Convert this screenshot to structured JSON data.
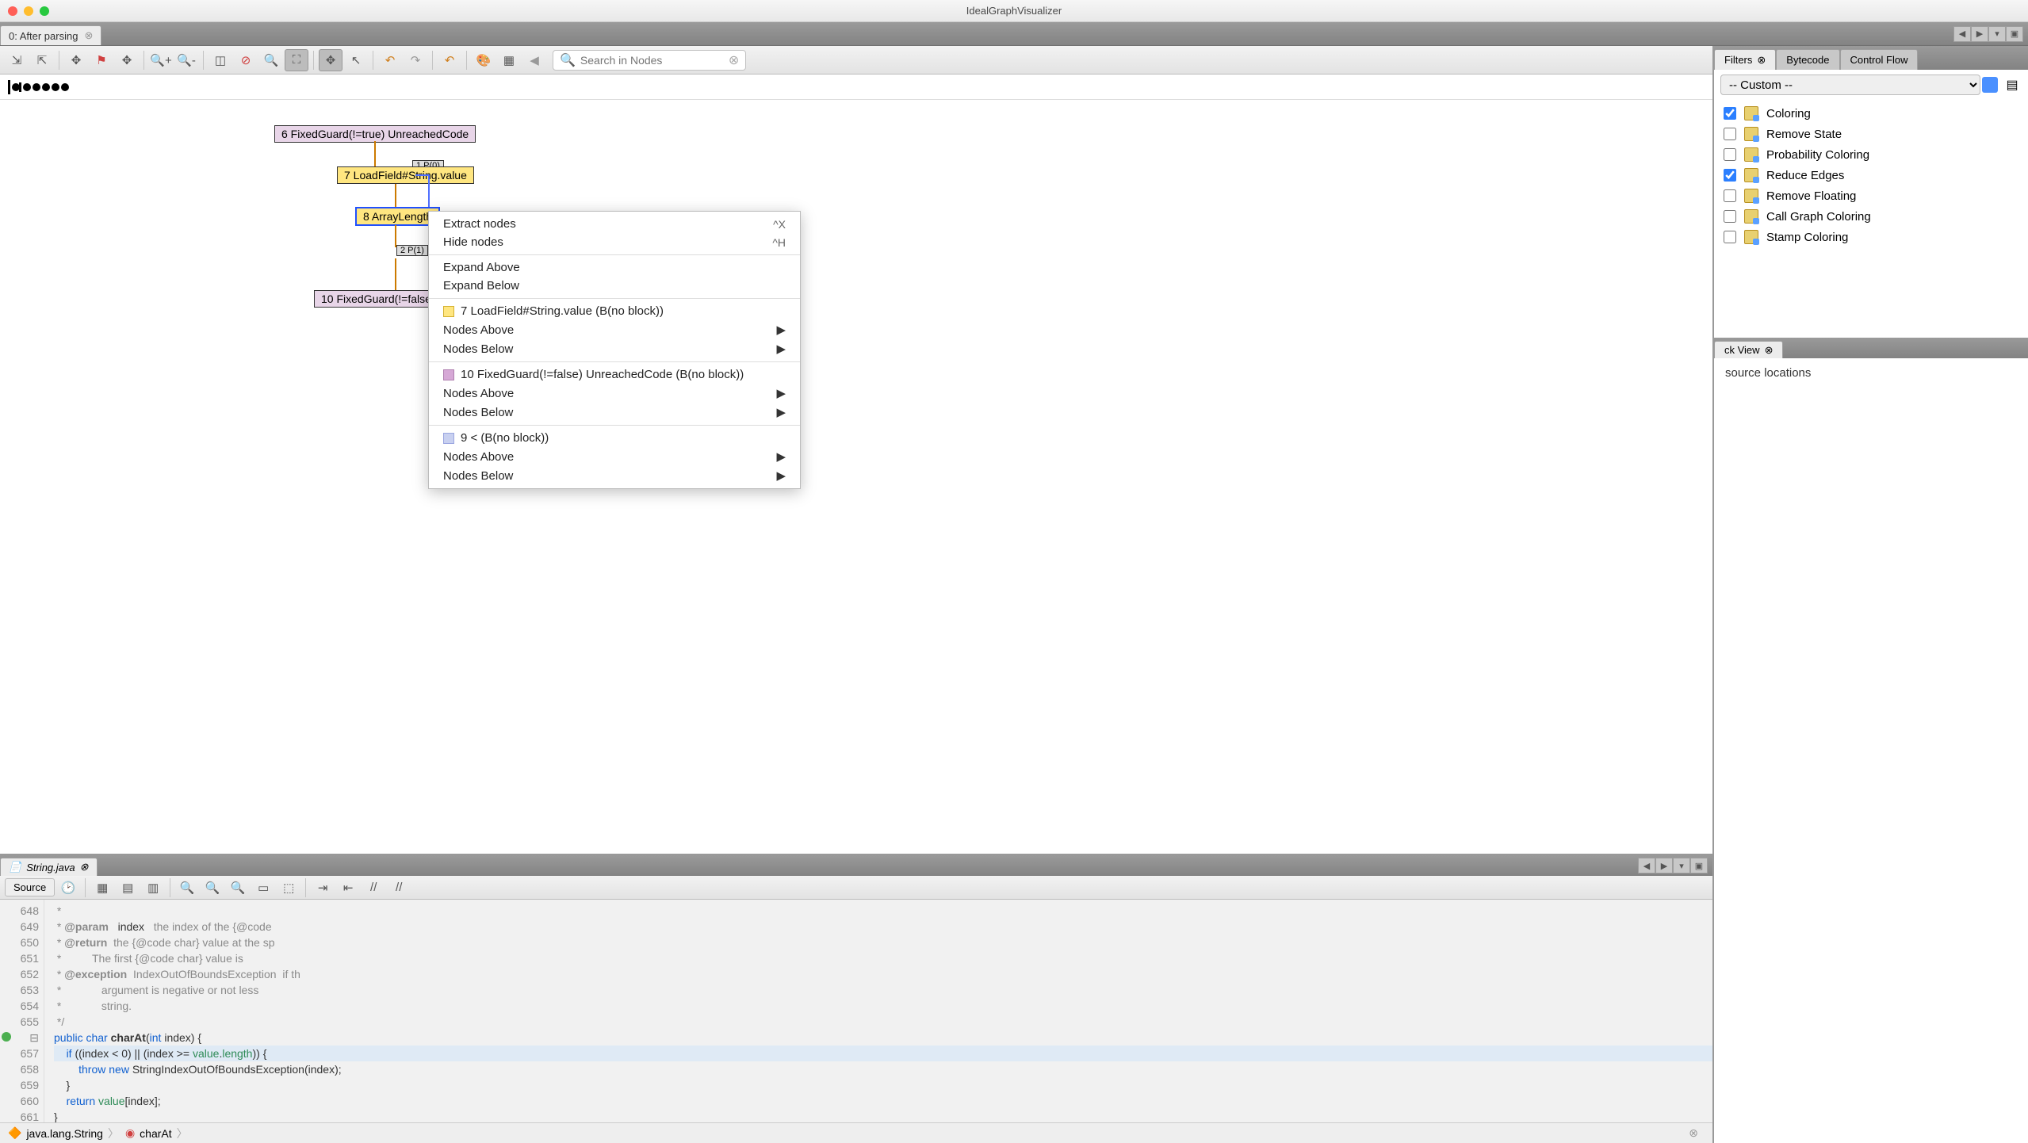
{
  "window": {
    "title": "IdealGraphVisualizer"
  },
  "doc_tab": {
    "label": "0: After parsing"
  },
  "search": {
    "placeholder": "Search in Nodes"
  },
  "graph": {
    "node6": "6 FixedGuard(!=true) UnreachedCode",
    "node7": "7 LoadField#String.value",
    "node8": "8 ArrayLength",
    "node10": "10 FixedGuard(!=false",
    "p0": "1 P(0)",
    "p1": "2 P(1)"
  },
  "ctx": {
    "extract": "Extract nodes",
    "extract_sc": "^X",
    "hide": "Hide nodes",
    "hide_sc": "^H",
    "expand_above": "Expand Above",
    "expand_below": "Expand Below",
    "n7": "7 LoadField#String.value (B(no block))",
    "nodes_above": "Nodes Above",
    "nodes_below": "Nodes Below",
    "n10": "10 FixedGuard(!=false) UnreachedCode (B(no block))",
    "n9": "9 < (B(no block))"
  },
  "right": {
    "tabs": {
      "filters": "Filters",
      "bytecode": "Bytecode",
      "cflow": "Control Flow"
    },
    "dropdown": "-- Custom --",
    "filters": [
      {
        "label": "Coloring",
        "checked": true
      },
      {
        "label": "Remove State",
        "checked": false
      },
      {
        "label": "Probability Coloring",
        "checked": false
      },
      {
        "label": "Reduce Edges",
        "checked": true
      },
      {
        "label": "Remove Floating",
        "checked": false
      },
      {
        "label": "Call Graph Coloring",
        "checked": false
      },
      {
        "label": "Stamp Coloring",
        "checked": false
      }
    ],
    "stack_tab": "ck View",
    "src_msg": "source locations"
  },
  "editor": {
    "file_tab": "String.java",
    "source_btn": "Source",
    "lines": {
      "648": " *",
      "649": " * @param   index   the index of the {@code",
      "650": " * @return  the {@code char} value at the sp",
      "651": " *          The first {@code char} value is",
      "652": " * @exception  IndexOutOfBoundsException  if th",
      "653": " *             argument is negative or not less",
      "654": " *             string.",
      "655": " */",
      "656": "public char charAt(int index) {",
      "657": "    if ((index < 0) || (index >= value.length)) {",
      "658": "        throw new StringIndexOutOfBoundsException(index);",
      "659": "    }",
      "660": "    return value[index];",
      "661": "}"
    },
    "breadcrumb": {
      "class": "java.lang.String",
      "method": "charAt"
    }
  }
}
